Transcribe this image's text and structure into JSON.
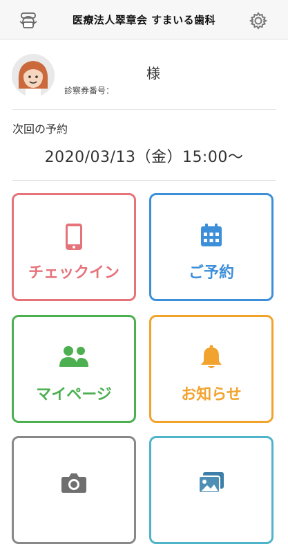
{
  "header": {
    "title": "医療法人翠章会 すまいる歯科",
    "left_icon": "dentist-mask-icon",
    "right_icon": "gear-icon"
  },
  "profile": {
    "avatar": "woman-avatar",
    "name_suffix": "様",
    "patient_no_label": "診察券番号："
  },
  "next_appointment": {
    "label": "次回の予約",
    "datetime": "2020/03/13（金）15:00〜"
  },
  "tiles": [
    {
      "label": "チェックイン",
      "icon": "smartphone-icon",
      "color": "#e5737a"
    },
    {
      "label": "ご予約",
      "icon": "calendar-icon",
      "color": "#3d8fd9"
    },
    {
      "label": "マイページ",
      "icon": "users-icon",
      "color": "#4caf50"
    },
    {
      "label": "お知らせ",
      "icon": "bell-icon",
      "color": "#f1a32e"
    },
    {
      "label": "",
      "icon": "camera-icon",
      "color": "#888888"
    },
    {
      "label": "",
      "icon": "gallery-icon",
      "color": "#4fb3c9"
    }
  ]
}
